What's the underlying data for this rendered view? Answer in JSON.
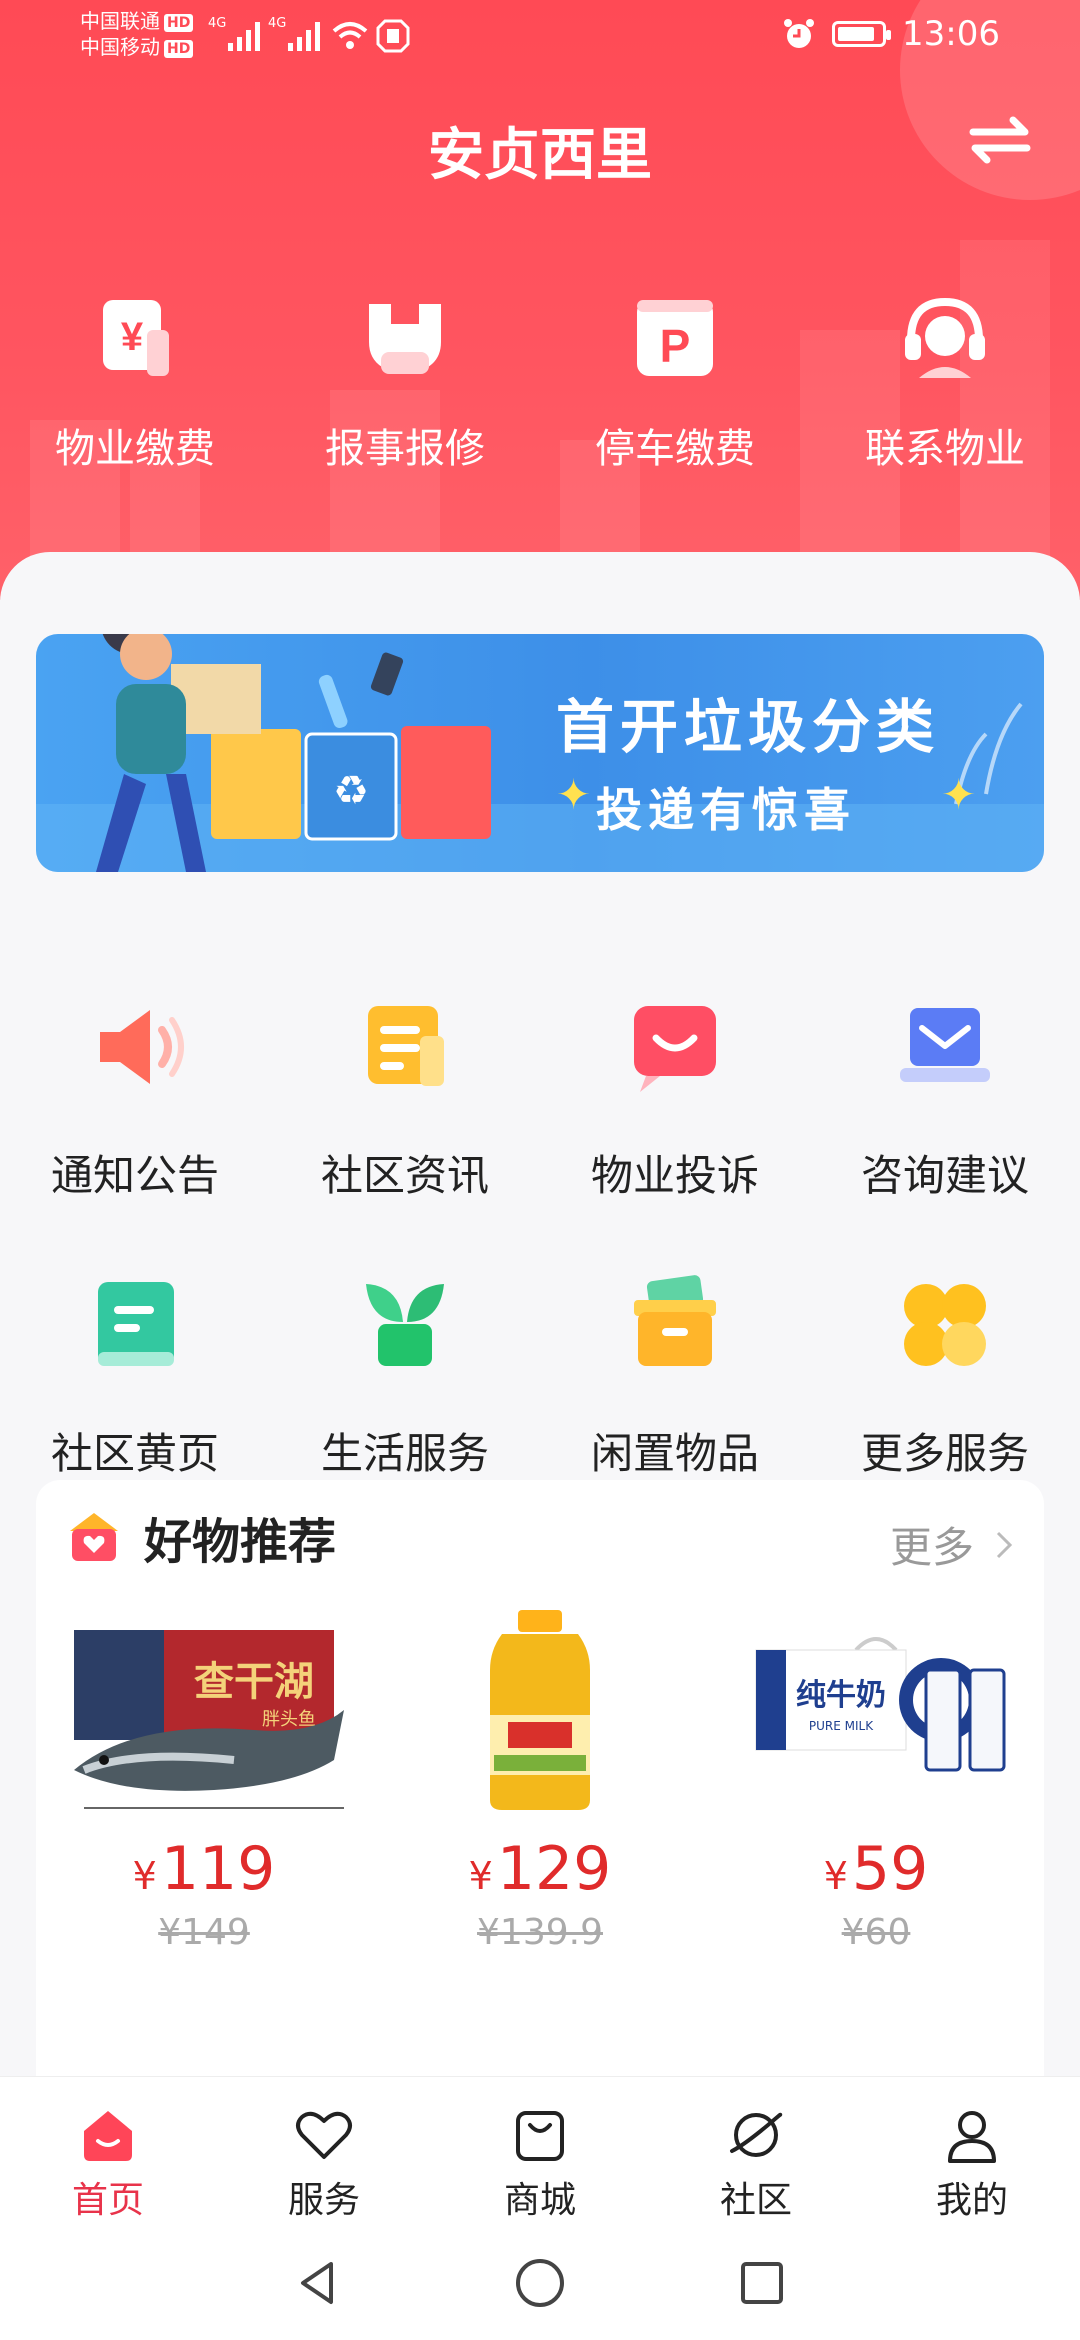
{
  "status": {
    "carrier1": "中国联通",
    "carrier2": "中国移动",
    "hd_badge": "HD",
    "net1": "4G",
    "net2": "4G",
    "time": "13:06"
  },
  "header": {
    "title": "安贞西里",
    "switch_icon": "swap-icon"
  },
  "top_actions": [
    {
      "label": "物业缴费",
      "icon": "yuan-bill-icon",
      "glyph": "¥"
    },
    {
      "label": "报事报修",
      "icon": "wrench-icon",
      "glyph": ""
    },
    {
      "label": "停车缴费",
      "icon": "parking-icon",
      "glyph": "P"
    },
    {
      "label": "联系物业",
      "icon": "headset-icon",
      "glyph": ""
    }
  ],
  "banner": {
    "line1": "首开垃圾分类",
    "line2": "投递有惊喜"
  },
  "services_row1": [
    {
      "label": "通知公告",
      "icon": "megaphone-icon"
    },
    {
      "label": "社区资讯",
      "icon": "news-icon"
    },
    {
      "label": "物业投诉",
      "icon": "smile-chat-icon"
    },
    {
      "label": "咨询建议",
      "icon": "mail-laptop-icon"
    }
  ],
  "services_row2": [
    {
      "label": "社区黄页",
      "icon": "book-icon"
    },
    {
      "label": "生活服务",
      "icon": "plant-icon"
    },
    {
      "label": "闲置物品",
      "icon": "box-icon"
    },
    {
      "label": "更多服务",
      "icon": "clover-icon"
    }
  ],
  "recommend": {
    "title": "好物推荐",
    "more": "更多",
    "products": [
      {
        "name": "fish-product",
        "box_text": "查干湖",
        "box_sub": "胖头鱼",
        "price": "119",
        "old_price": "¥149"
      },
      {
        "name": "oil-product",
        "price": "129",
        "old_price": "¥139.9"
      },
      {
        "name": "milk-product",
        "box_text": "纯牛奶",
        "box_sub": "PURE MILK",
        "price": "59",
        "old_price": "¥60"
      }
    ],
    "currency": "¥"
  },
  "tabs": [
    {
      "label": "首页",
      "icon": "home-icon",
      "active": true
    },
    {
      "label": "服务",
      "icon": "heart-icon",
      "active": false
    },
    {
      "label": "商城",
      "icon": "shopping-bag-icon",
      "active": false
    },
    {
      "label": "社区",
      "icon": "planet-icon",
      "active": false
    },
    {
      "label": "我的",
      "icon": "user-icon",
      "active": false
    }
  ],
  "colors": {
    "brand_red": "#ff4a55",
    "price_red": "#e02b2b",
    "banner_blue": "#3d8fe8"
  }
}
